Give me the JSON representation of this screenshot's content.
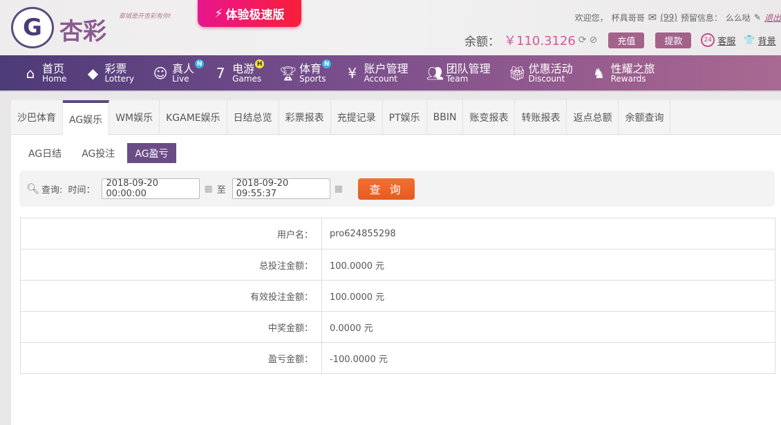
{
  "header": {
    "logo_text": "杏彩",
    "slogan": "泰城是开杏彩有你!",
    "fast_version": "体验极速版",
    "welcome": "欢迎您，",
    "username": "杯具哥哥",
    "mail_count": "(99)",
    "reserved_label": "预留信息：",
    "reserved_value": "么么哒",
    "logout": "退出",
    "balance_label": "余额：",
    "balance_value": "￥110.3126",
    "deposit": "充值",
    "withdraw": "提款",
    "service": "客服",
    "background": "背景"
  },
  "nav": [
    {
      "zh": "首页",
      "en": "Home",
      "icon": "home-icon"
    },
    {
      "zh": "彩票",
      "en": "Lottery",
      "icon": "ticket-icon"
    },
    {
      "zh": "真人",
      "en": "Live",
      "icon": "dealer-icon",
      "badge": "N"
    },
    {
      "zh": "电游",
      "en": "Games",
      "icon": "seven-icon",
      "badge": "H"
    },
    {
      "zh": "体育",
      "en": "Sports",
      "icon": "trophy-icon",
      "badge": "N"
    },
    {
      "zh": "账户管理",
      "en": "Account",
      "icon": "yen-icon"
    },
    {
      "zh": "团队管理",
      "en": "Team",
      "icon": "team-icon"
    },
    {
      "zh": "优惠活动",
      "en": "Discount",
      "icon": "gift-icon"
    },
    {
      "zh": "性耀之旅",
      "en": "Rewards",
      "icon": "rewards-icon"
    }
  ],
  "tabs": [
    "沙巴体育",
    "AG娱乐",
    "WM娱乐",
    "KGAME娱乐",
    "日结总览",
    "彩票报表",
    "充提记录",
    "PT娱乐",
    "BBIN",
    "账变报表",
    "转账报表",
    "返点总额",
    "余额查询"
  ],
  "subtabs": [
    "AG日结",
    "AG投注",
    "AG盈亏"
  ],
  "search": {
    "label": "查询:",
    "time_label": "时间：",
    "start": "2018-09-20 00:00:00",
    "to": "至",
    "end": "2018-09-20 09:55:37",
    "button": "查 询"
  },
  "rows": [
    {
      "label": "用户名：",
      "value": "pro624855298"
    },
    {
      "label": "总投注金额：",
      "value": "100.0000 元"
    },
    {
      "label": "有效投注金额：",
      "value": "100.0000 元"
    },
    {
      "label": "中奖金额：",
      "value": "0.0000 元"
    },
    {
      "label": "盈亏金额：",
      "value": "-100.0000 元"
    }
  ],
  "colors": {
    "nav_start": "#4d3b78",
    "nav_end": "#a86a92",
    "accent": "#6a4c86",
    "query_button": "#e65a20",
    "balance": "#d05a9a"
  }
}
